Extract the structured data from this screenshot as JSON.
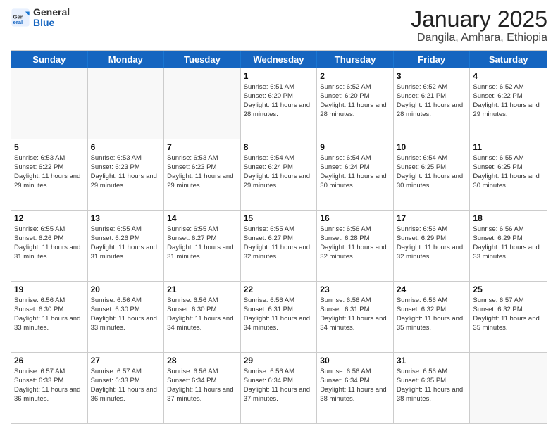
{
  "header": {
    "logo": {
      "general": "General",
      "blue": "Blue"
    },
    "title": "January 2025",
    "location": "Dangila, Amhara, Ethiopia"
  },
  "days_of_week": [
    "Sunday",
    "Monday",
    "Tuesday",
    "Wednesday",
    "Thursday",
    "Friday",
    "Saturday"
  ],
  "weeks": [
    [
      {
        "day": "",
        "sunrise": "",
        "sunset": "",
        "daylight": "",
        "empty": true
      },
      {
        "day": "",
        "sunrise": "",
        "sunset": "",
        "daylight": "",
        "empty": true
      },
      {
        "day": "",
        "sunrise": "",
        "sunset": "",
        "daylight": "",
        "empty": true
      },
      {
        "day": "1",
        "sunrise": "Sunrise: 6:51 AM",
        "sunset": "Sunset: 6:20 PM",
        "daylight": "Daylight: 11 hours and 28 minutes.",
        "empty": false
      },
      {
        "day": "2",
        "sunrise": "Sunrise: 6:52 AM",
        "sunset": "Sunset: 6:20 PM",
        "daylight": "Daylight: 11 hours and 28 minutes.",
        "empty": false
      },
      {
        "day": "3",
        "sunrise": "Sunrise: 6:52 AM",
        "sunset": "Sunset: 6:21 PM",
        "daylight": "Daylight: 11 hours and 28 minutes.",
        "empty": false
      },
      {
        "day": "4",
        "sunrise": "Sunrise: 6:52 AM",
        "sunset": "Sunset: 6:22 PM",
        "daylight": "Daylight: 11 hours and 29 minutes.",
        "empty": false
      }
    ],
    [
      {
        "day": "5",
        "sunrise": "Sunrise: 6:53 AM",
        "sunset": "Sunset: 6:22 PM",
        "daylight": "Daylight: 11 hours and 29 minutes.",
        "empty": false
      },
      {
        "day": "6",
        "sunrise": "Sunrise: 6:53 AM",
        "sunset": "Sunset: 6:23 PM",
        "daylight": "Daylight: 11 hours and 29 minutes.",
        "empty": false
      },
      {
        "day": "7",
        "sunrise": "Sunrise: 6:53 AM",
        "sunset": "Sunset: 6:23 PM",
        "daylight": "Daylight: 11 hours and 29 minutes.",
        "empty": false
      },
      {
        "day": "8",
        "sunrise": "Sunrise: 6:54 AM",
        "sunset": "Sunset: 6:24 PM",
        "daylight": "Daylight: 11 hours and 29 minutes.",
        "empty": false
      },
      {
        "day": "9",
        "sunrise": "Sunrise: 6:54 AM",
        "sunset": "Sunset: 6:24 PM",
        "daylight": "Daylight: 11 hours and 30 minutes.",
        "empty": false
      },
      {
        "day": "10",
        "sunrise": "Sunrise: 6:54 AM",
        "sunset": "Sunset: 6:25 PM",
        "daylight": "Daylight: 11 hours and 30 minutes.",
        "empty": false
      },
      {
        "day": "11",
        "sunrise": "Sunrise: 6:55 AM",
        "sunset": "Sunset: 6:25 PM",
        "daylight": "Daylight: 11 hours and 30 minutes.",
        "empty": false
      }
    ],
    [
      {
        "day": "12",
        "sunrise": "Sunrise: 6:55 AM",
        "sunset": "Sunset: 6:26 PM",
        "daylight": "Daylight: 11 hours and 31 minutes.",
        "empty": false
      },
      {
        "day": "13",
        "sunrise": "Sunrise: 6:55 AM",
        "sunset": "Sunset: 6:26 PM",
        "daylight": "Daylight: 11 hours and 31 minutes.",
        "empty": false
      },
      {
        "day": "14",
        "sunrise": "Sunrise: 6:55 AM",
        "sunset": "Sunset: 6:27 PM",
        "daylight": "Daylight: 11 hours and 31 minutes.",
        "empty": false
      },
      {
        "day": "15",
        "sunrise": "Sunrise: 6:55 AM",
        "sunset": "Sunset: 6:27 PM",
        "daylight": "Daylight: 11 hours and 32 minutes.",
        "empty": false
      },
      {
        "day": "16",
        "sunrise": "Sunrise: 6:56 AM",
        "sunset": "Sunset: 6:28 PM",
        "daylight": "Daylight: 11 hours and 32 minutes.",
        "empty": false
      },
      {
        "day": "17",
        "sunrise": "Sunrise: 6:56 AM",
        "sunset": "Sunset: 6:29 PM",
        "daylight": "Daylight: 11 hours and 32 minutes.",
        "empty": false
      },
      {
        "day": "18",
        "sunrise": "Sunrise: 6:56 AM",
        "sunset": "Sunset: 6:29 PM",
        "daylight": "Daylight: 11 hours and 33 minutes.",
        "empty": false
      }
    ],
    [
      {
        "day": "19",
        "sunrise": "Sunrise: 6:56 AM",
        "sunset": "Sunset: 6:30 PM",
        "daylight": "Daylight: 11 hours and 33 minutes.",
        "empty": false
      },
      {
        "day": "20",
        "sunrise": "Sunrise: 6:56 AM",
        "sunset": "Sunset: 6:30 PM",
        "daylight": "Daylight: 11 hours and 33 minutes.",
        "empty": false
      },
      {
        "day": "21",
        "sunrise": "Sunrise: 6:56 AM",
        "sunset": "Sunset: 6:30 PM",
        "daylight": "Daylight: 11 hours and 34 minutes.",
        "empty": false
      },
      {
        "day": "22",
        "sunrise": "Sunrise: 6:56 AM",
        "sunset": "Sunset: 6:31 PM",
        "daylight": "Daylight: 11 hours and 34 minutes.",
        "empty": false
      },
      {
        "day": "23",
        "sunrise": "Sunrise: 6:56 AM",
        "sunset": "Sunset: 6:31 PM",
        "daylight": "Daylight: 11 hours and 34 minutes.",
        "empty": false
      },
      {
        "day": "24",
        "sunrise": "Sunrise: 6:56 AM",
        "sunset": "Sunset: 6:32 PM",
        "daylight": "Daylight: 11 hours and 35 minutes.",
        "empty": false
      },
      {
        "day": "25",
        "sunrise": "Sunrise: 6:57 AM",
        "sunset": "Sunset: 6:32 PM",
        "daylight": "Daylight: 11 hours and 35 minutes.",
        "empty": false
      }
    ],
    [
      {
        "day": "26",
        "sunrise": "Sunrise: 6:57 AM",
        "sunset": "Sunset: 6:33 PM",
        "daylight": "Daylight: 11 hours and 36 minutes.",
        "empty": false
      },
      {
        "day": "27",
        "sunrise": "Sunrise: 6:57 AM",
        "sunset": "Sunset: 6:33 PM",
        "daylight": "Daylight: 11 hours and 36 minutes.",
        "empty": false
      },
      {
        "day": "28",
        "sunrise": "Sunrise: 6:56 AM",
        "sunset": "Sunset: 6:34 PM",
        "daylight": "Daylight: 11 hours and 37 minutes.",
        "empty": false
      },
      {
        "day": "29",
        "sunrise": "Sunrise: 6:56 AM",
        "sunset": "Sunset: 6:34 PM",
        "daylight": "Daylight: 11 hours and 37 minutes.",
        "empty": false
      },
      {
        "day": "30",
        "sunrise": "Sunrise: 6:56 AM",
        "sunset": "Sunset: 6:34 PM",
        "daylight": "Daylight: 11 hours and 38 minutes.",
        "empty": false
      },
      {
        "day": "31",
        "sunrise": "Sunrise: 6:56 AM",
        "sunset": "Sunset: 6:35 PM",
        "daylight": "Daylight: 11 hours and 38 minutes.",
        "empty": false
      },
      {
        "day": "",
        "sunrise": "",
        "sunset": "",
        "daylight": "",
        "empty": true
      }
    ]
  ]
}
